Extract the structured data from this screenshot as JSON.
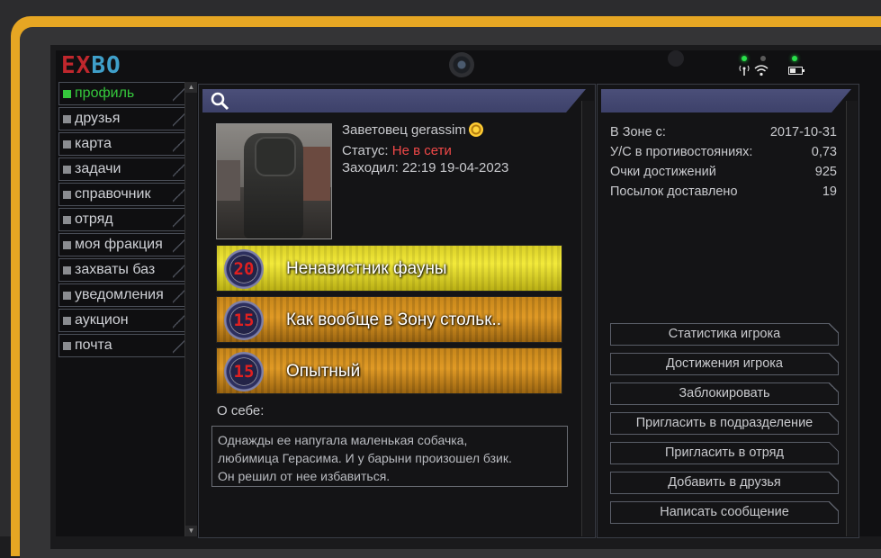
{
  "logo": {
    "part1": "EX",
    "part2": "BO"
  },
  "status_icons": {
    "signal": "signal-antenna-icon",
    "wifi": "wifi-icon",
    "battery": "battery-icon"
  },
  "sidebar": {
    "items": [
      {
        "label": "профиль",
        "active": true
      },
      {
        "label": "друзья"
      },
      {
        "label": "карта"
      },
      {
        "label": "задачи"
      },
      {
        "label": "справочник"
      },
      {
        "label": "отряд"
      },
      {
        "label": "моя фракция"
      },
      {
        "label": "захваты баз"
      },
      {
        "label": "уведомления"
      },
      {
        "label": "аукцион"
      },
      {
        "label": "почта"
      }
    ]
  },
  "profile": {
    "name": "Заветовец gerassim",
    "status_label": "Статус:",
    "status_value": "Не в сети",
    "last_seen": "Заходил: 22:19 19-04-2023",
    "achievements": [
      {
        "level": "20",
        "title": "Ненавистник фауны",
        "color": "yellow"
      },
      {
        "level": "15",
        "title": "Как вообще в Зону стольк..",
        "color": "orange"
      },
      {
        "level": "15",
        "title": "Опытный",
        "color": "orange"
      }
    ],
    "about_label": "О себе:",
    "about_text_1": "Однажды ее напугала маленькая собачка,",
    "about_text_2": "любимица Герасима. И у барыни произошел бзик.",
    "about_text_3": "Он решил от нее избавиться."
  },
  "stats": {
    "rows": [
      {
        "label": "В Зоне с:",
        "value": "2017-10-31"
      },
      {
        "label": "У/С в противостояниях:",
        "value": "0,73"
      },
      {
        "label": "Очки достижений",
        "value": "925"
      },
      {
        "label": "Посылок доставлено",
        "value": "19"
      }
    ],
    "buttons": [
      "Статистика игрока",
      "Достижения игрока",
      "Заблокировать",
      "Пригласить в подразделение",
      "Пригласить в отряд",
      "Добавить в друзья",
      "Написать сообщение"
    ]
  },
  "colors": {
    "bezel": "#e6a623",
    "active": "#35c83c",
    "offline": "#f04848",
    "header": "#4b4f79"
  }
}
